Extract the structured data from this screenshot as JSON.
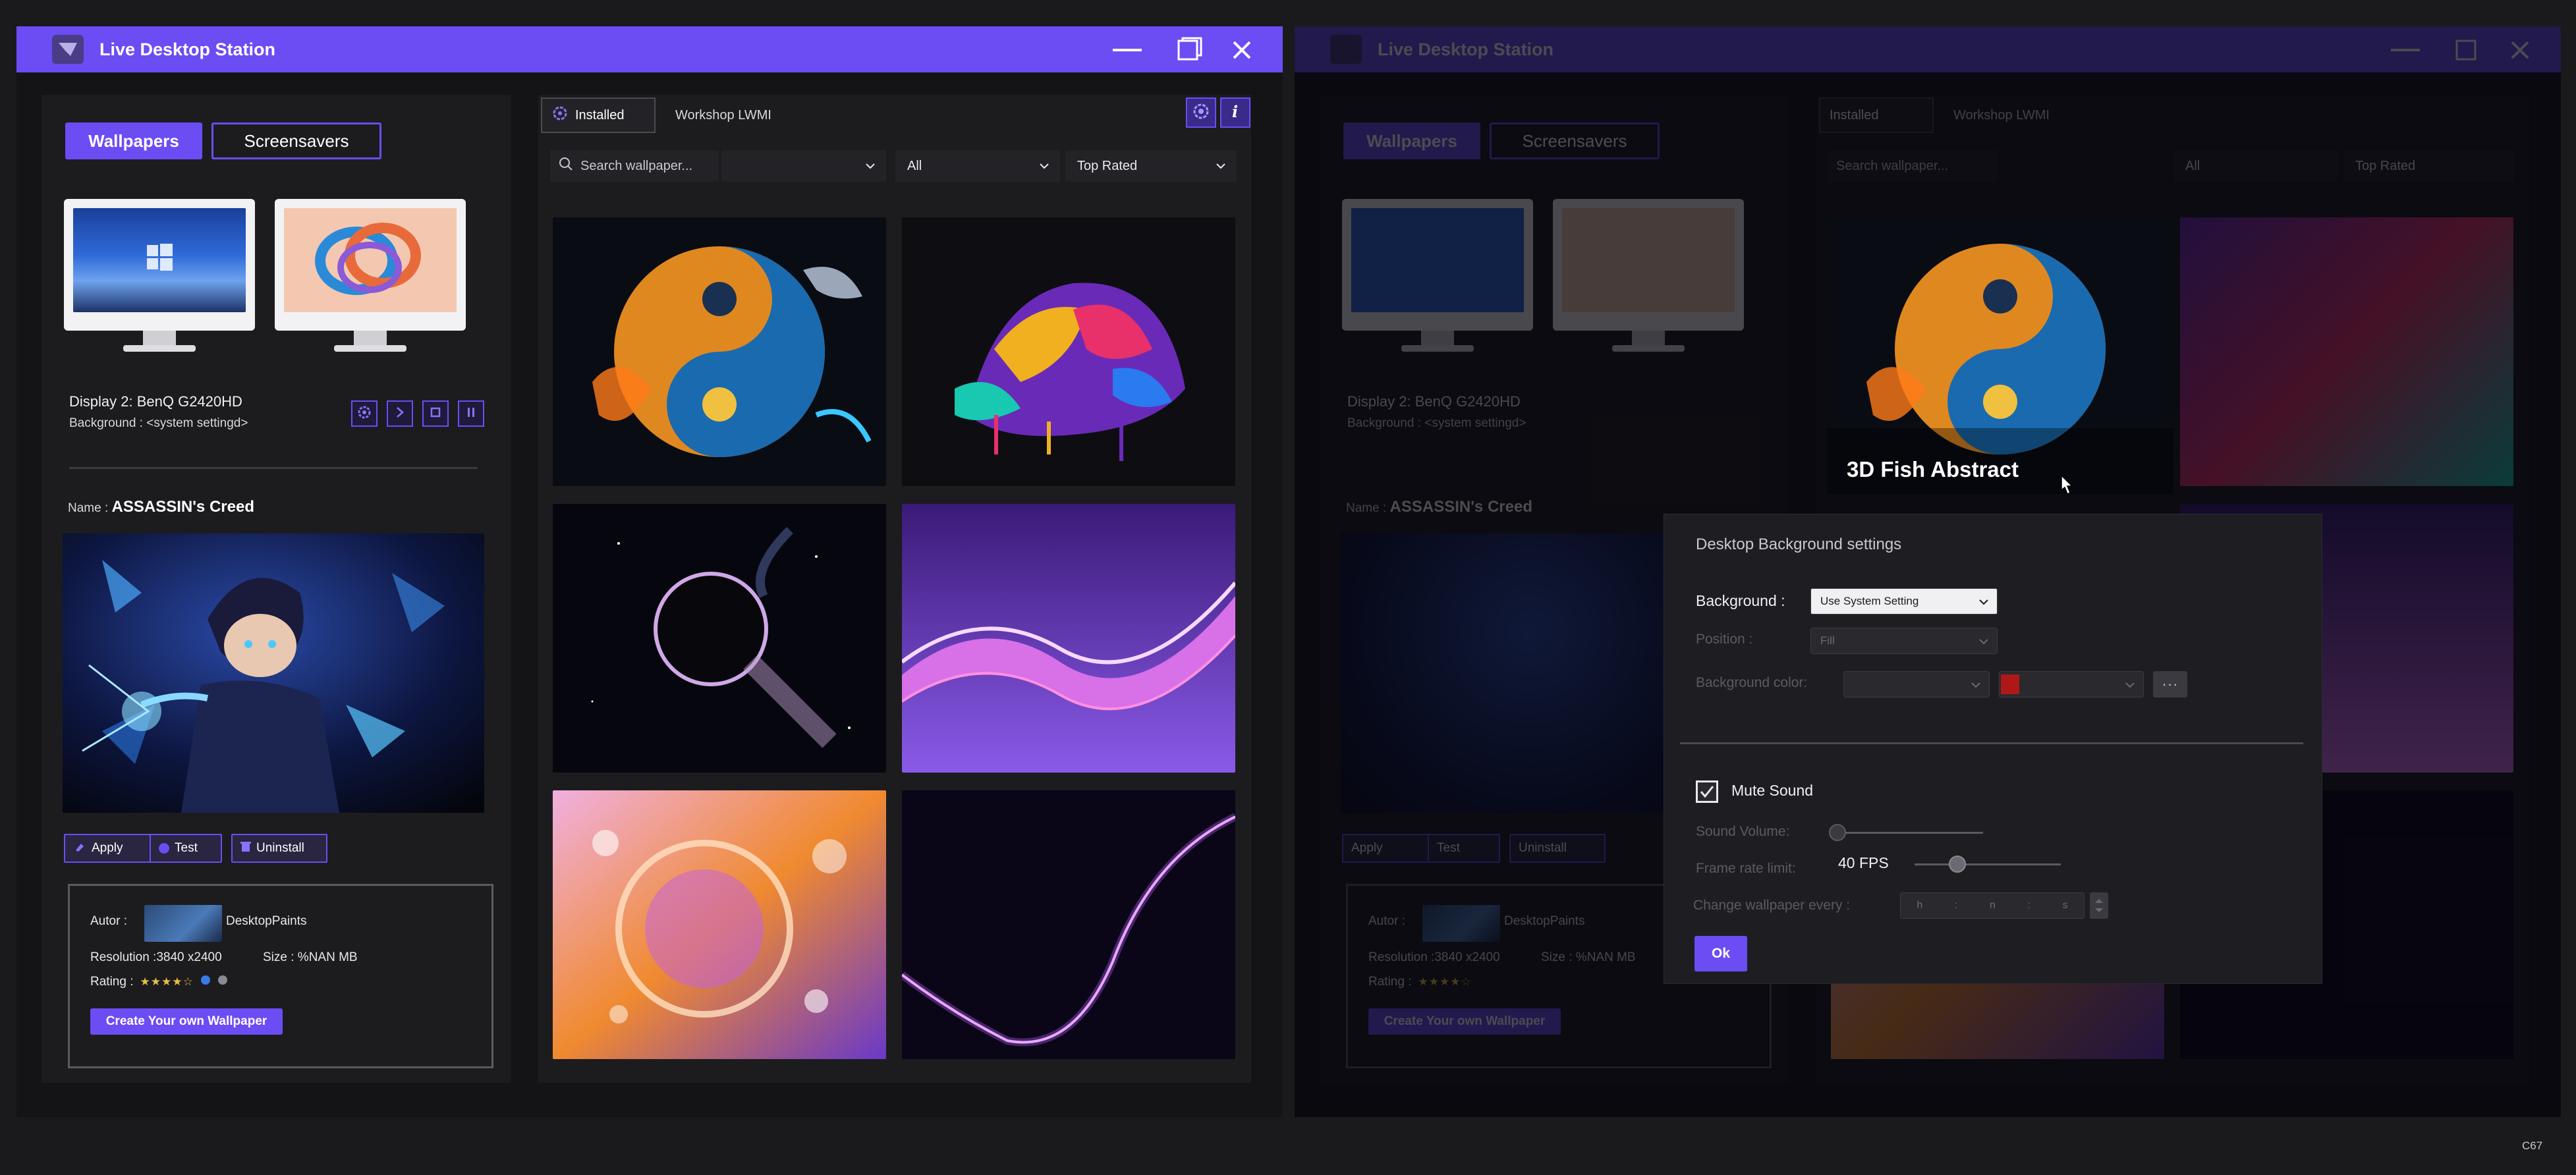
{
  "app": {
    "title": "Live Desktop Station"
  },
  "sidebar": {
    "wallpapers_label": "Wallpapers",
    "screensavers_label": "Screensavers",
    "display_name": "Display 2: BenQ G2420HD",
    "background_text": "Background : <system settingd>",
    "name_label": "Name : ",
    "name_value": "ASSASSIN's Creed",
    "actions": {
      "apply": "Apply",
      "test": "Test",
      "uninstall": "Uninstall"
    },
    "info": {
      "autor_label": "Autor :",
      "autor_name": "DesktopPaints",
      "resolution": "Resolution :3840 x2400",
      "size": "Size : %NAN MB",
      "rating_label": "Rating :",
      "rating_value": 4,
      "rating_max": 5,
      "create_button": "Create Your own Wallpaper"
    }
  },
  "gallery": {
    "tabs": {
      "installed": "Installed",
      "workshop": "Workshop LWMI"
    },
    "search_placeholder": "Search wallpaper...",
    "filter_1": "",
    "filter_2": "All",
    "sort": "Top Rated",
    "hover_title": "3D Fish  Abstract"
  },
  "settings_dialog": {
    "title": "Desktop Background settings",
    "background_label": "Background :",
    "background_value": "Use System Setting",
    "position_label": "Position :",
    "position_value": "Fill",
    "bg_color_label": "Background color:",
    "bg_color_value": "",
    "bg_color_2": "",
    "mute_label": "Mute Sound",
    "mute_checked": true,
    "volume_label": "Sound Volume:",
    "volume_level": 0,
    "framerate_label": "Frame rate limit:",
    "fps_value": "40 FPS",
    "change_label": "Change wallpaper  every :",
    "time_h": "h",
    "time_m": "n",
    "time_s": "s",
    "ok_label": "Ok"
  },
  "colors": {
    "accent": "#6c4cf3",
    "background": "#141416",
    "panel": "#1c1c1f"
  },
  "footer_code": "C67"
}
